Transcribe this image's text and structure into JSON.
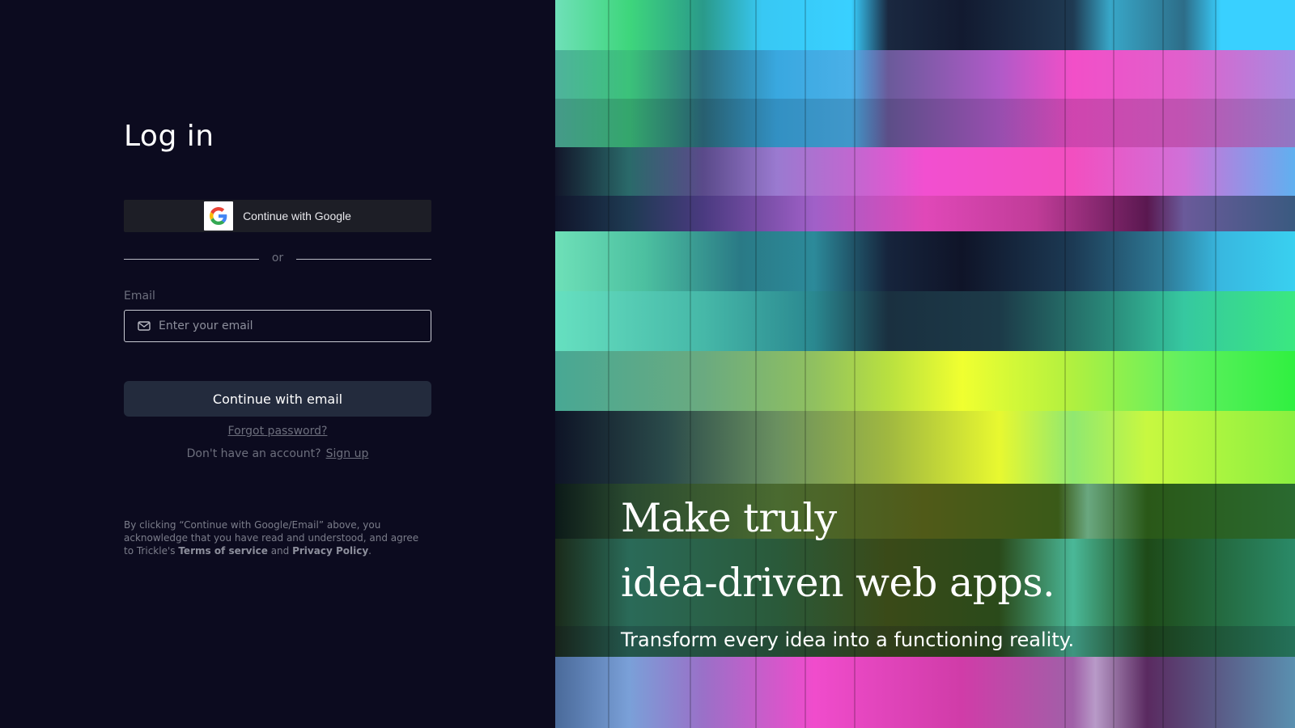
{
  "login": {
    "title": "Log in",
    "google_button_label": "Continue with Google",
    "divider_text": "or",
    "email_label": "Email",
    "email_placeholder": "Enter your email",
    "email_value": "",
    "continue_email_label": "Continue with email",
    "forgot_password": "Forgot password?",
    "no_account_text": "Don't have an account?",
    "signup_link": "Sign up",
    "legal_prefix": "By clicking “Continue with Google/Email” above, you acknowledge that you have read and understood, and agree to Trickle's",
    "terms_link": "Terms of service",
    "and_text": "and",
    "privacy_link": "Privacy Policy",
    "period": "."
  },
  "hero": {
    "headline_line1": "Make truly",
    "headline_line2": "idea-driven web apps.",
    "subline": "Transform every idea into a functioning reality."
  },
  "icons": {
    "google": "google-g-icon",
    "email": "mail-icon"
  },
  "colors": {
    "background": "#0c0b1f",
    "button_dark": "#232b3d",
    "google_button": "#1d1e26"
  }
}
